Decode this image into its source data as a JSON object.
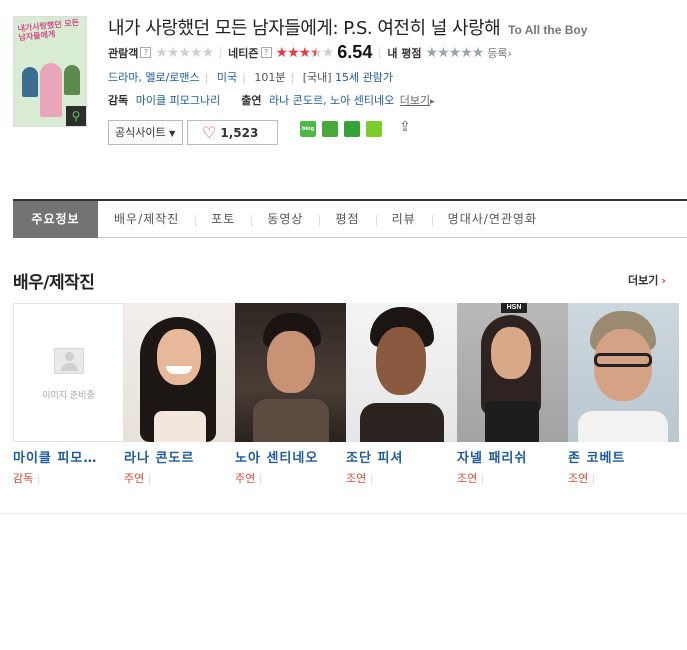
{
  "movie": {
    "title_ko": "내가 사랑했던 모든 남자들에게: P.S. 여전히 널 사랑해",
    "title_en": "To All the Boy",
    "poster_title": "내가사랑했던 모든남자들에게",
    "audience_label": "관람객",
    "audience_stars": 0,
    "netizen_label": "네티즌",
    "netizen_score": "6.54",
    "netizen_stars": 3.5,
    "my_label": "내 평점",
    "register_label": "등록",
    "genres": "드라마, 멜로/로맨스",
    "country": "미국",
    "runtime": "101분",
    "rating_region": "[국내]",
    "rating": "15세 관람가",
    "director_label": "감독",
    "director": "마이클 피모그나리",
    "cast_label": "출연",
    "cast_names": "라나 콘도르, 노아 센티네오",
    "more_label": "더보기",
    "official_site": "공식사이트",
    "likes": "1,523"
  },
  "tabs": [
    "주요정보",
    "배우/제작진",
    "포토",
    "동영상",
    "평점",
    "리뷰",
    "명대사/연관영화"
  ],
  "section": {
    "title": "배우/제작진",
    "more": "더보기"
  },
  "cast": [
    {
      "name": "마이클 피모…",
      "role": "감독",
      "no_image": "이미지 준비중"
    },
    {
      "name": "라나 콘도르",
      "role": "주연"
    },
    {
      "name": "노아 센티네오",
      "role": "주연"
    },
    {
      "name": "조단 피셔",
      "role": "조연"
    },
    {
      "name": "자넬 패리쉬",
      "role": "조연"
    },
    {
      "name": "존 코베트",
      "role": "조연"
    }
  ],
  "colors": {
    "accent_red": "#e83a45",
    "link_blue": "#1d5b9b",
    "tab_active": "#737373"
  }
}
